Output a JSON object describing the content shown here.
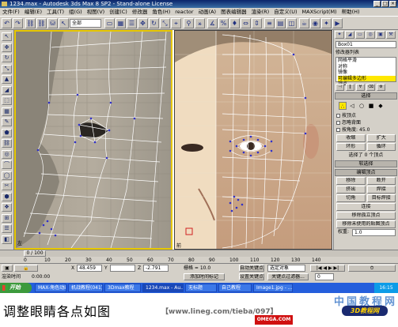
{
  "window": {
    "title": "1234.max - Autodesk 3ds Max 8 SP2 - Stand-alone License"
  },
  "menu": [
    "文件(F)",
    "编辑(E)",
    "工具(T)",
    "组(G)",
    "视图(V)",
    "创建(C)",
    "修改器",
    "角色(H)",
    "reactor",
    "动画(A)",
    "图表编辑器",
    "渲染(R)",
    "自定义(U)",
    "MAXScript(M)",
    "帮助(H)"
  ],
  "toolbar": {
    "selection_filter": "全部",
    "buttons": [
      "↶",
      "↷",
      "⛓",
      "⛓",
      "⛁",
      "↖",
      "▭",
      "▦",
      "☰",
      "✥",
      "↻",
      "⤡",
      "⌖",
      "⚲",
      "⚹",
      "∡",
      "%",
      "♦",
      "⇔",
      "⇕",
      "≡",
      "▤",
      "◫",
      "☕",
      "◉",
      "✦",
      "▶"
    ]
  },
  "left_tools": [
    "↖",
    "✥",
    "↻",
    "⤡",
    "▲",
    "◢",
    "⬚",
    "▦",
    "✎",
    "⬟",
    "⛓",
    "◎",
    "⌒",
    "◯",
    "✂",
    "⬢",
    "❖",
    "⊞",
    "☰",
    "◧"
  ],
  "command_panel": {
    "tabs": [
      "✦",
      "◢",
      "▭",
      "◎",
      "▣",
      "⚒"
    ],
    "object_name": "Box01",
    "modifier_list_label": "修改器列表",
    "stack": [
      {
        "label": "网格平滑",
        "selected": false
      },
      {
        "label": "对称",
        "selected": false
      },
      {
        "label": "镜像",
        "selected": false
      },
      {
        "label": "可编辑多边形",
        "selected": true
      },
      {
        "label": "顶点",
        "selected": false
      }
    ],
    "stack_tool_icons": [
      "⊣",
      "‖",
      "∀",
      "⌫",
      "⚙"
    ],
    "rollouts": {
      "selection": "选择",
      "soft_selection": "软选择",
      "edit_vertices": "编辑顶点"
    },
    "subobject_icons": [
      "∴",
      "◁",
      "○",
      "■",
      "◆"
    ],
    "checkboxes": [
      "按顶点",
      "忽略背面",
      "按角度:"
    ],
    "angle_value": "45.0",
    "selection_buttons": [
      [
        "收缩",
        "扩大"
      ],
      [
        "环形",
        "循环"
      ]
    ],
    "selection_info": "选择了 0 个顶点",
    "edit_buttons": [
      [
        "移除",
        "断开"
      ],
      [
        "挤出",
        "焊接"
      ],
      [
        "切角",
        "目标焊接"
      ],
      [
        "连接"
      ],
      [
        "移除孤立顶点"
      ],
      [
        "移除未使用的贴图顶点"
      ]
    ],
    "weight_label": "权重:",
    "weight_value": "1.0"
  },
  "viewports": {
    "left": {
      "label": "左"
    },
    "right": {
      "label": "前"
    }
  },
  "timeline": {
    "thumb_label": "0 / 100",
    "ticks": [
      "0",
      "10",
      "20",
      "30",
      "40",
      "50",
      "60",
      "70",
      "80",
      "90",
      "100",
      "110",
      "120",
      "130",
      "140"
    ]
  },
  "status": {
    "row1": {
      "coord_x": "48.459",
      "coord_y": "",
      "coord_z": "-2.791",
      "grid": "栅格 = 10.0",
      "auto_key": "自动关键点",
      "selected_object": "选定对象",
      "set_key": "设置关键点",
      "key_filters": "关键点过滤器..."
    },
    "row2": {
      "script_label": "渲染时间",
      "time": "0:00:00",
      "add_time_tag": "添加时间标记",
      "frame": "0"
    }
  },
  "taskbar": {
    "start": "开始",
    "tasks": [
      "MAX-角色动画",
      "机战教程(041)",
      "3Dmax教程",
      "1234.max - Au...",
      "无标题",
      "自己教程",
      "Image1.jpg - ..."
    ],
    "tray_time": "16:15"
  },
  "caption": {
    "text": "调整眼睛各点如图",
    "url": "【www.lineg.com/tieba/097】",
    "watermark": "中国教程网",
    "logo": "3D教程网",
    "badge": "OMEGA.COM"
  }
}
